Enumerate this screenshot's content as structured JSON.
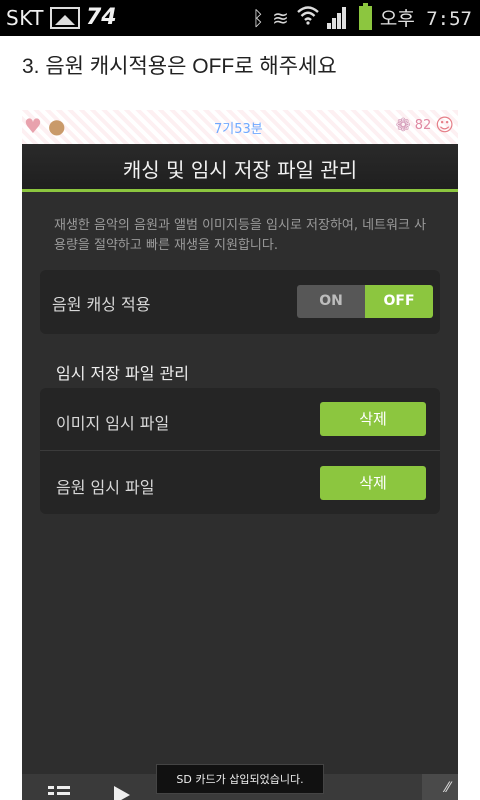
{
  "status_bar": {
    "carrier": "SKT",
    "notification_number": "74",
    "time": "오후 7:57",
    "icons": [
      "gallery-icon",
      "bluetooth-icon",
      "vibrate-icon",
      "wifi-icon",
      "signal-icon",
      "battery-icon"
    ]
  },
  "instruction": "3. 음원 캐시적용은 OFF로 해주세요",
  "decoration": {
    "center_text": "7기53분",
    "right_count": "82"
  },
  "screen": {
    "title": "캐싱 및 임시 저장 파일 관리",
    "description": "재생한 음악의 음원과 앨범 이미지등을 임시로 저장하여, 네트워크 사용량을 절약하고 빠른 재생을 지원합니다.",
    "cache_row": {
      "label": "음원 캐싱 적용",
      "on_label": "ON",
      "off_label": "OFF",
      "selected": "OFF"
    },
    "temp_section": {
      "title": "임시 저장 파일 관리",
      "rows": [
        {
          "label": "이미지 임시 파일",
          "button": "삭제"
        },
        {
          "label": "음원 임시 파일",
          "button": "삭제"
        }
      ]
    }
  },
  "toast": "SD 카드가 삽입되었습니다.",
  "colors": {
    "accent": "#8cc63f",
    "background": "#2e2e2e",
    "card": "#252525"
  }
}
